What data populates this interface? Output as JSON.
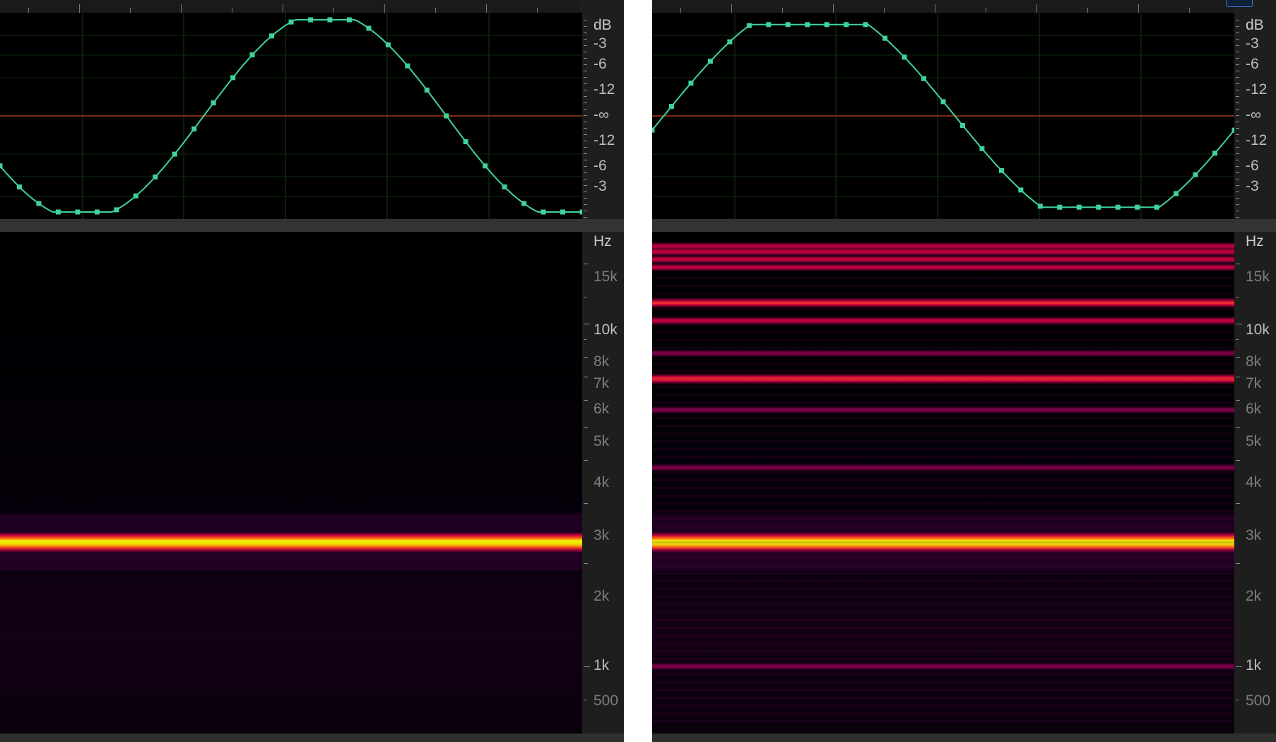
{
  "db_axis": {
    "unit": "dB",
    "labels": [
      "-3",
      "-6",
      "-12",
      "-∞",
      "-12",
      "-6",
      "-3"
    ]
  },
  "hz_axis": {
    "unit": "Hz",
    "labels": [
      "15k",
      "10k",
      "8k",
      "7k",
      "6k",
      "5k",
      "4k",
      "3k",
      "2k",
      "1k",
      "500"
    ],
    "major": [
      "10k",
      "1k"
    ]
  },
  "panes": [
    {
      "name": "left",
      "waveform": {
        "color": "#3fd39b",
        "shape": "sine",
        "cycles": 1.2,
        "phase_start": 0.58
      },
      "spectrogram": {
        "bands": [
          {
            "freq": "2.3k",
            "intensity": 1.0
          }
        ]
      }
    },
    {
      "name": "right",
      "waveform": {
        "color": "#3fd39b",
        "shape": "rounded-sine",
        "cycles": 1.0,
        "phase_start": 0.98
      },
      "spectrogram": {
        "bands": [
          {
            "freq": "16.8k",
            "intensity": 0.55
          },
          {
            "freq": "16.2k",
            "intensity": 0.45
          },
          {
            "freq": "15.4k",
            "intensity": 0.5
          },
          {
            "freq": "14.6k",
            "intensity": 0.45
          },
          {
            "freq": "11.5k",
            "intensity": 0.7
          },
          {
            "freq": "10.2k",
            "intensity": 0.5
          },
          {
            "freq": "8.2k",
            "intensity": 0.35
          },
          {
            "freq": "6.9k",
            "intensity": 0.75
          },
          {
            "freq": "5.6k",
            "intensity": 0.4
          },
          {
            "freq": "3.8k",
            "intensity": 0.35
          },
          {
            "freq": "2.3k",
            "intensity": 1.0
          },
          {
            "freq": "1k",
            "intensity": 0.38
          }
        ]
      }
    }
  ],
  "colors": {
    "wave_bg": "#000000",
    "zero_line": "#a23a1e",
    "grid": "#123c12",
    "panel_bg": "#1e1e1e"
  }
}
